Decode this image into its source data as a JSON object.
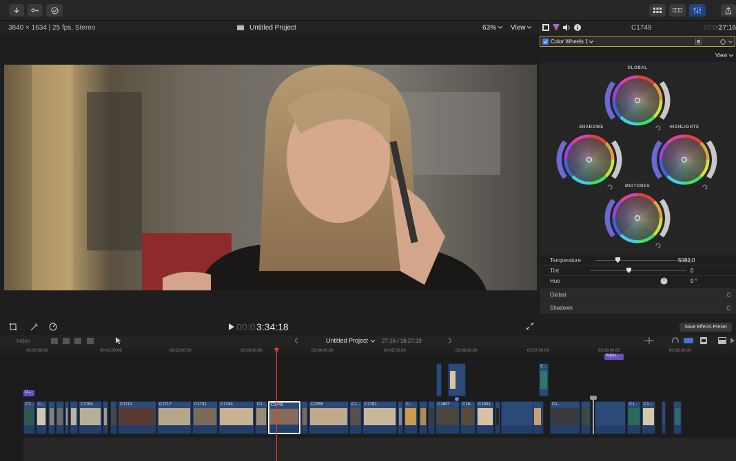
{
  "viewer": {
    "format": "3840 × 1634 | 25 fps, Stereo",
    "project_title": "Untitled Project",
    "zoom": "63%",
    "view_label": "View",
    "timecode_dim": "00:0",
    "timecode": "3:34:18"
  },
  "inspector": {
    "clip_name": "C1749",
    "duration_dim": "00:00:",
    "duration": "27:16",
    "effect_name": "Color Wheels 1",
    "view_label": "View",
    "wheels": {
      "global": "GLOBAL",
      "shadows": "SHADOWS",
      "highlights": "HIGHLIGHTS",
      "midtones": "MIDTONES"
    },
    "params": [
      {
        "label": "Temperature",
        "value": "5082,0"
      },
      {
        "label": "Tint",
        "value": "0"
      },
      {
        "label": "Hue",
        "value": "0 °"
      }
    ],
    "sections": [
      "Global",
      "Shadows"
    ],
    "save_preset": "Save Effects Preset"
  },
  "timeline": {
    "index_label": "Index",
    "project_title": "Untitled Project",
    "duration": "27:16 / 16:27:19",
    "ruler": [
      "00:00:00:00",
      "00:01:00:00",
      "00:02:00:00",
      "00:03:00:00",
      "00:04:00:00",
      "00:05:00:00",
      "00:06:00:00",
      "00:07:00:00",
      "00:08:00:00",
      "00:09:00:00"
    ],
    "clips": [
      "C1...",
      "C...",
      "C1794",
      "C1712",
      "C1717",
      "C1731",
      "C1743",
      "C1...",
      "C1749",
      "C1765",
      "C1...",
      "C1781",
      "C...",
      "C1897",
      "C18...",
      "C1901",
      "C1...",
      "C1...",
      "C1..."
    ],
    "audio_label": "U...",
    "connected_label": "C...",
    "adjust_label": "Adjus..."
  },
  "colors": {
    "accent": "#c8a332",
    "clip_blue": "#2c4a78",
    "playhead": "#d9433a",
    "selected_border": "#ffffff"
  }
}
